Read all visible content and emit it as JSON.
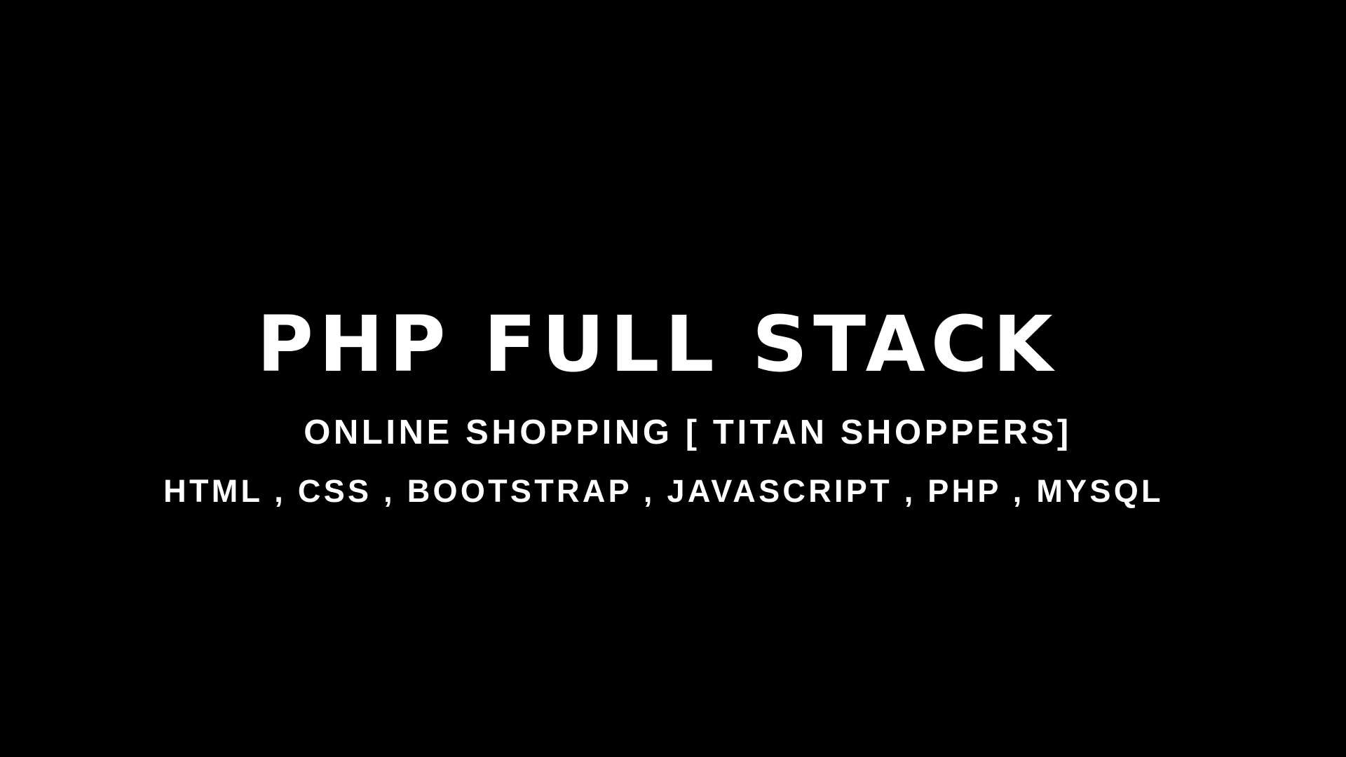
{
  "slide": {
    "title": "PHP FULL STACK",
    "subtitle": "ONLINE SHOPPING [ TITAN SHOPPERS]",
    "technologies": "HTML , CSS , BOOTSTRAP , JAVASCRIPT , PHP , MYSQL"
  },
  "colors": {
    "background": "#000000",
    "text": "#ffffff"
  }
}
